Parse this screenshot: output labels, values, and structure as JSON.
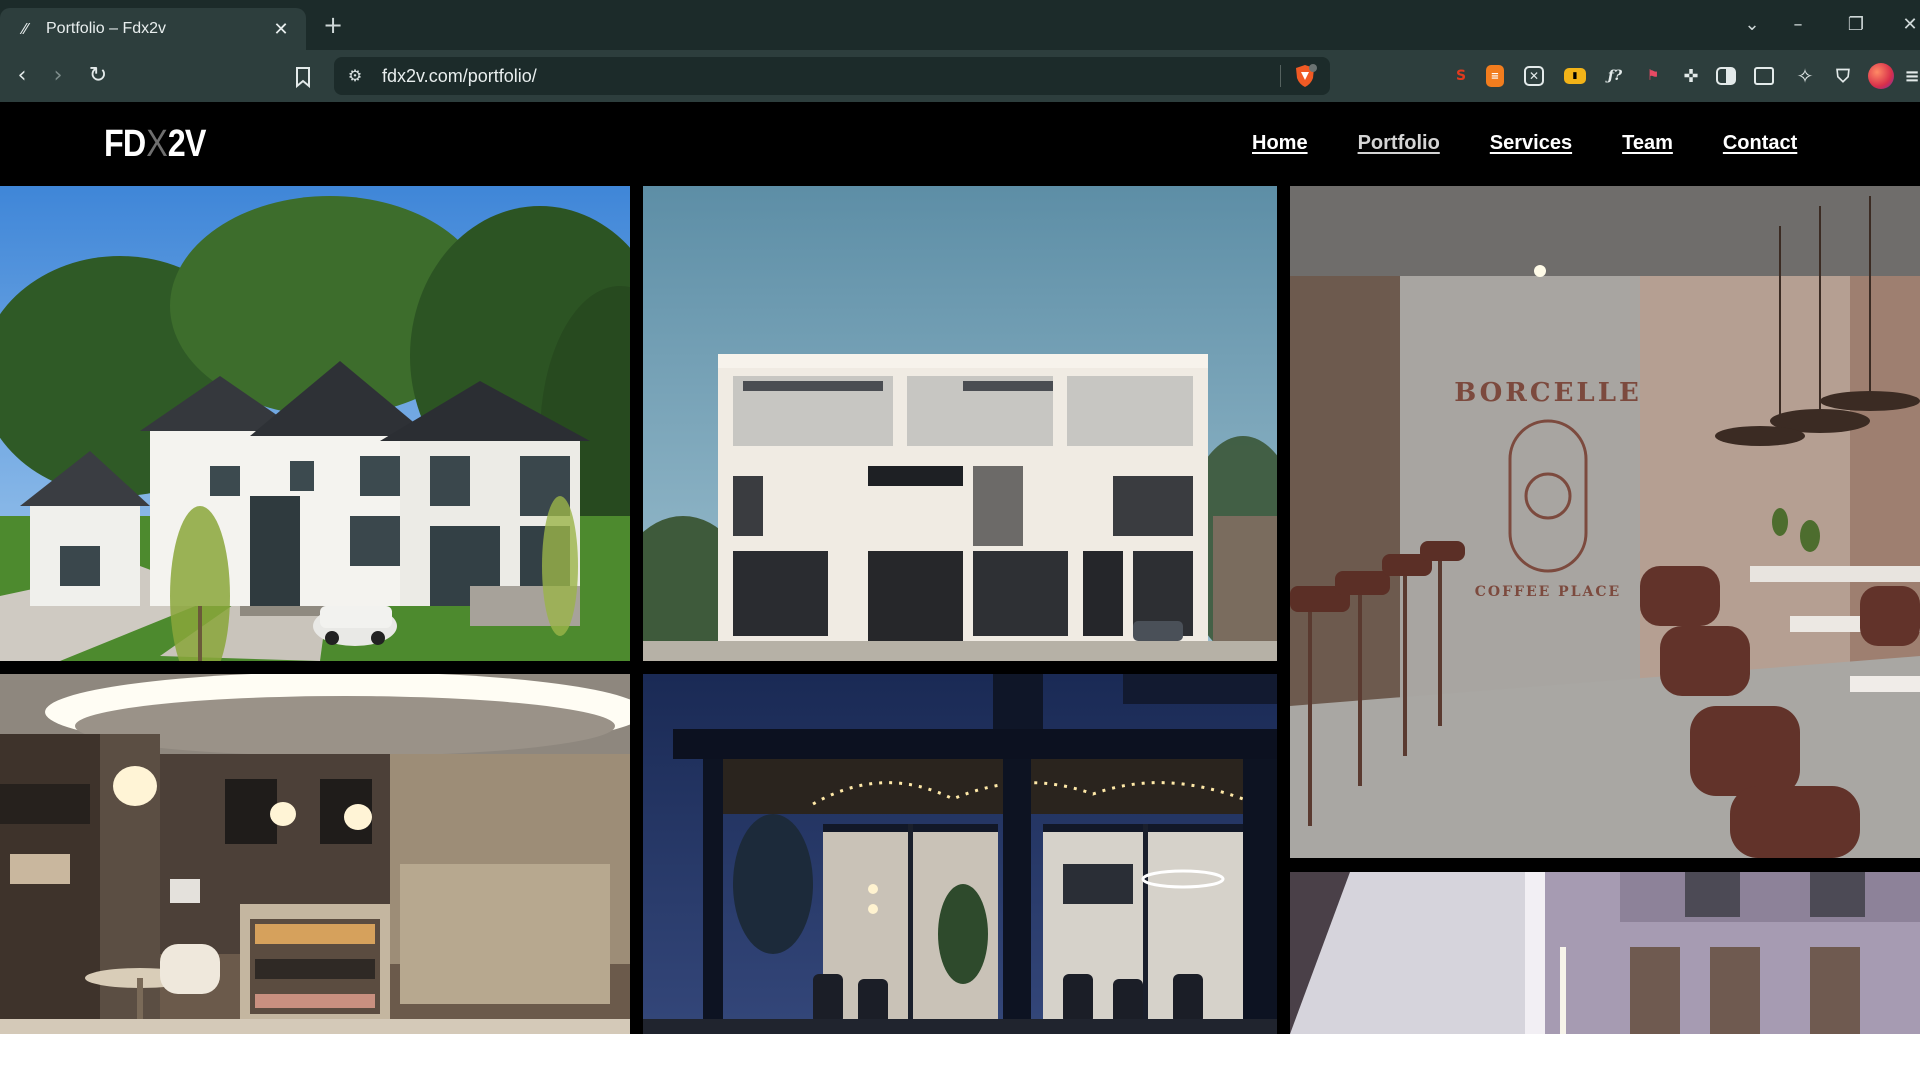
{
  "browser": {
    "tab": {
      "title": "Portfolio – Fdx2v",
      "favicon_icon": "fdx2v-favicon-icon",
      "close_icon": "close-icon"
    },
    "new_tab_icon": "plus-icon",
    "window_controls": [
      "chevron-down-icon",
      "minimize-icon",
      "restore-icon",
      "close-icon"
    ],
    "address_bar": {
      "url": "fdx2v.com/portfolio/",
      "site_info_icon": "tune-icon"
    },
    "extensions": [
      "seo-extension-icon",
      "orange-note-icon",
      "grid-extension-icon",
      "yellow-tag-icon",
      "fx-icon",
      "pin-icon",
      "puzzle-icon",
      "sidebar-icon",
      "wallet-icon",
      "sparkle-icon",
      "vpn-shield-icon",
      "profile-icon",
      "menu-icon"
    ]
  },
  "site": {
    "logo": {
      "part1": "FD",
      "part2": "X",
      "part3": "2V"
    },
    "nav": [
      {
        "label": "Home",
        "active": false
      },
      {
        "label": "Portfolio",
        "active": true
      },
      {
        "label": "Services",
        "active": false
      },
      {
        "label": "Team",
        "active": false
      },
      {
        "label": "Contact",
        "active": false
      }
    ]
  },
  "portfolio": {
    "tiles": [
      {
        "name": "suburban-house-render",
        "kind": "exterior-day"
      },
      {
        "name": "modern-white-building-render",
        "kind": "exterior-day"
      },
      {
        "name": "borcelle-coffee-interior-render",
        "kind": "interior",
        "sign_text": "BORCELLE",
        "sign_subtext": "COFFEE PLACE"
      },
      {
        "name": "bakery-counter-interior-render",
        "kind": "interior"
      },
      {
        "name": "night-pergola-dining-render",
        "kind": "exterior-night"
      },
      {
        "name": "purple-facade-building-render",
        "kind": "exterior-day"
      }
    ]
  }
}
